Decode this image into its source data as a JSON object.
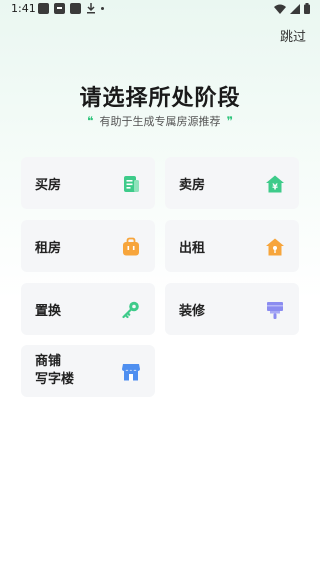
{
  "status": {
    "time": "1:41"
  },
  "header": {
    "skip_label": "跳过"
  },
  "main": {
    "title": "请选择所处阶段",
    "subtitle": "有助于生成专属房源推荐",
    "quote_open": "❞",
    "quote_close": "❞"
  },
  "options": {
    "buy": {
      "label": "买房",
      "icon": "document-icon",
      "color": "#3ecb8a"
    },
    "sell": {
      "label": "卖房",
      "icon": "house-yen-icon",
      "color": "#3ecb8a"
    },
    "rent": {
      "label": "租房",
      "icon": "bag-icon",
      "color": "#f7a53c"
    },
    "let": {
      "label": "出租",
      "icon": "house-key-icon",
      "color": "#f7a53c"
    },
    "swap": {
      "label": "置换",
      "icon": "key-icon",
      "color": "#3ecb8a"
    },
    "renovate": {
      "label": "装修",
      "icon": "brush-icon",
      "color": "#8b8cf0"
    },
    "commercial": {
      "label_line1": "商铺",
      "label_line2": "写字楼",
      "icon": "shop-icon",
      "color": "#4f8ff0"
    }
  }
}
